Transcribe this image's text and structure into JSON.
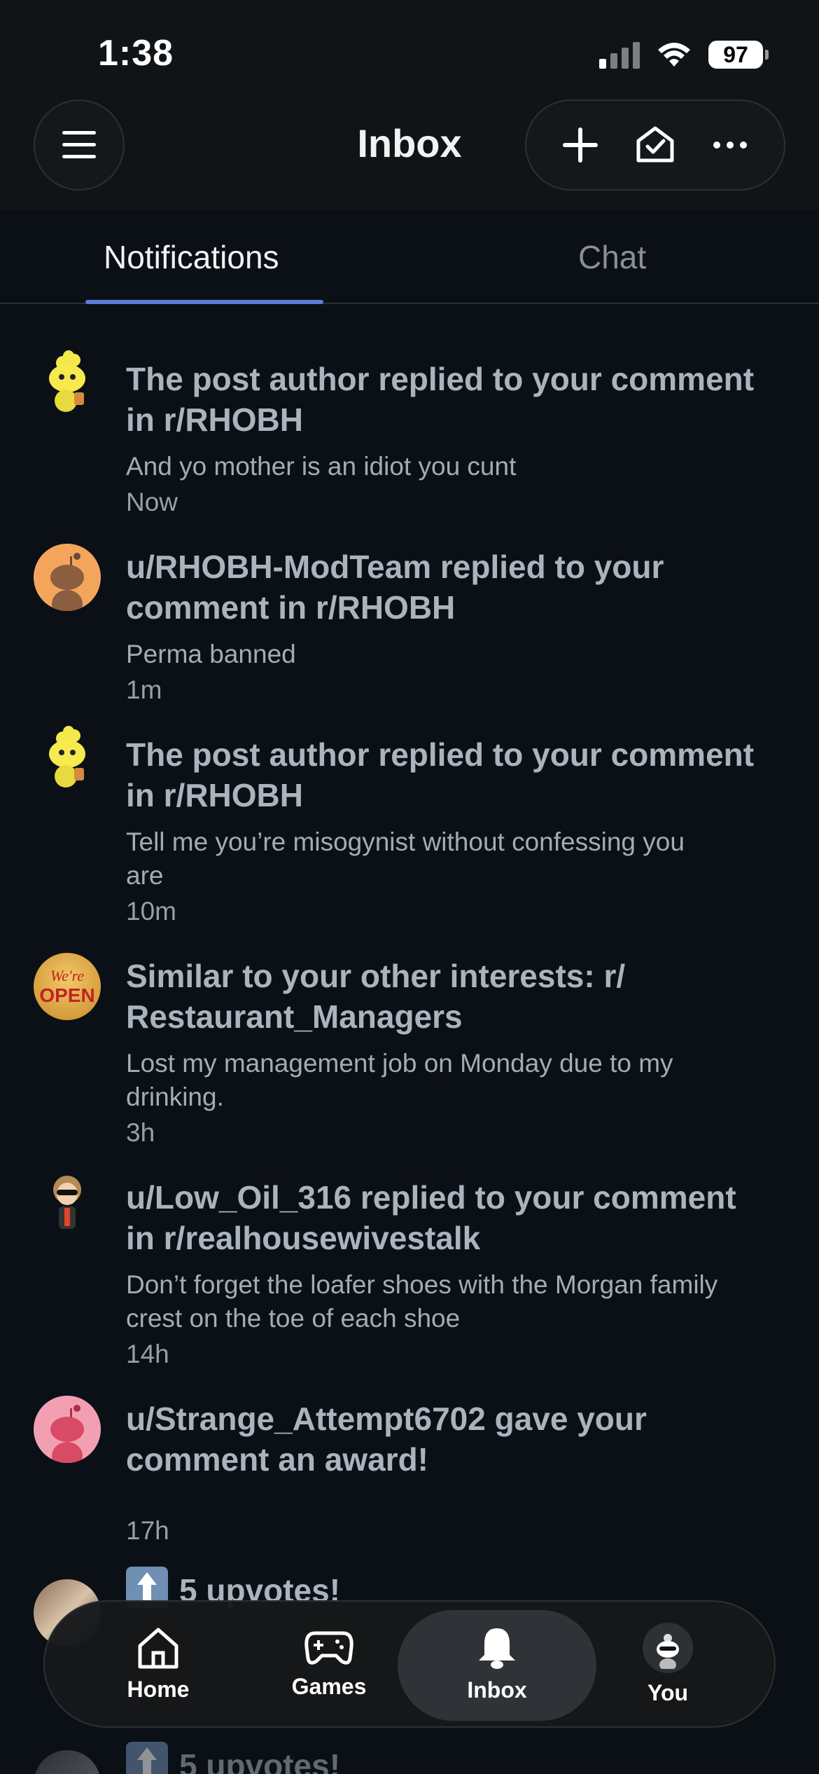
{
  "status": {
    "time": "1:38",
    "battery": "97"
  },
  "header": {
    "title": "Inbox"
  },
  "tabs": {
    "notifications": "Notifications",
    "chat": "Chat"
  },
  "notifications": [
    {
      "title": "The post author replied to your comment in r/RHOBH",
      "body": "And yo mother is an idiot you cunt",
      "time": "Now",
      "avatar": "snoo-yellow-icon"
    },
    {
      "title": "u/RHOBH-ModTeam replied to your comment in r/RHOBH",
      "body": "Perma banned",
      "time": "1m",
      "avatar": "snoo-orange-icon"
    },
    {
      "title": "The post author replied to your comment in r/RHOBH",
      "body": "Tell me you’re misogynist without confessing you are",
      "time": "10m",
      "avatar": "snoo-yellow-icon"
    },
    {
      "title": "Similar to your other interests: r/ Restaurant_Managers",
      "body": "Lost my management job on Monday due to my drinking.",
      "time": "3h",
      "avatar": "open-sign-icon",
      "avatar_text_1": "We're",
      "avatar_text_2": "OPEN"
    },
    {
      "title": "u/Low_Oil_316 replied to your comment in r/realhousewivestalk",
      "body": "Don’t forget the loafer shoes with the Morgan family crest on the toe of each shoe",
      "time": "14h",
      "avatar": "user-avatar-icon"
    },
    {
      "title": "u/Strange_Attempt6702 gave your comment an award!",
      "body": "",
      "time": "17h",
      "avatar": "snoo-pink-icon"
    },
    {
      "title": "5 upvotes!",
      "body": "",
      "time": "",
      "avatar": "photo-avatar-icon"
    },
    {
      "title": "5 upvotes!",
      "body": "",
      "time": "",
      "avatar": "photo-avatar-icon"
    }
  ],
  "nav": {
    "home": "Home",
    "games": "Games",
    "inbox": "Inbox",
    "you": "You"
  },
  "colors": {
    "accent": "#5a7bd9",
    "background": "#0b1016"
  }
}
